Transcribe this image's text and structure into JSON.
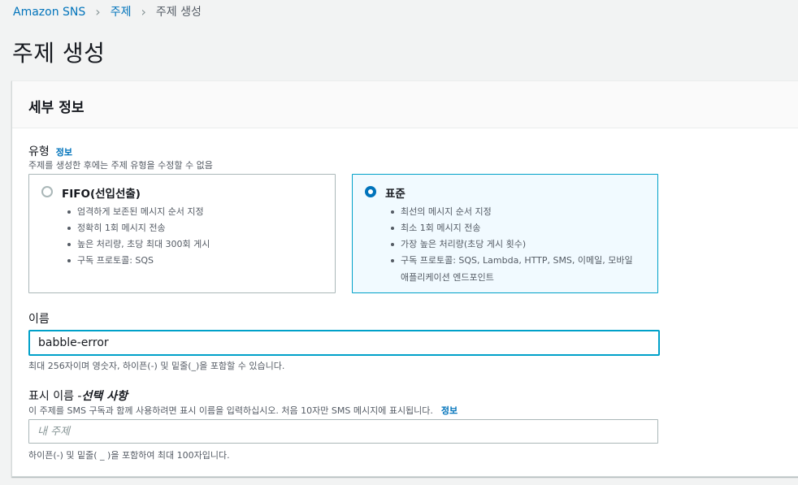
{
  "breadcrumb": {
    "items": [
      "Amazon SNS",
      "주제"
    ],
    "current": "주제 생성"
  },
  "page": {
    "title": "주제 생성"
  },
  "panel": {
    "title": "세부 정보"
  },
  "type_field": {
    "label": "유형",
    "info": "정보",
    "description": "주제를 생성한 후에는 주제 유형을 수정할 수 없음",
    "options": [
      {
        "title": "FIFO(선입선출)",
        "selected": false,
        "bullets": [
          "엄격하게 보존된 메시지 순서 지정",
          "정확히 1회 메시지 전송",
          "높은 처리량, 초당 최대 300회 게시",
          "구독 프로토콜: SQS"
        ]
      },
      {
        "title": "표준",
        "selected": true,
        "bullets": [
          "최선의 메시지 순서 지정",
          "최소 1회 메시지 전송",
          "가장 높은 처리량(초당 게시 횟수)",
          "구독 프로토콜: SQS, Lambda, HTTP, SMS, 이메일, 모바일",
          "애플리케이션 엔드포인트"
        ]
      }
    ]
  },
  "name_field": {
    "label": "이름",
    "value": "babble-error",
    "hint": "최대 256자이며 영숫자, 하이픈(-) 및 밑줄(_)을 포함할 수 있습니다."
  },
  "display_name_field": {
    "label": "표시 이름 - ",
    "label_optional": "선택 사항",
    "description": "이 주제를 SMS 구독과 함께 사용하려면 표시 이름을 입력하십시오. 처음 10자만 SMS 메시지에 표시됩니다.",
    "info": "정보",
    "placeholder": "내 주제",
    "hint": "하이픈(-) 및 밑줄( _ )을 포함하여 최대 100자입니다."
  },
  "colors": {
    "accent": "#0073bb",
    "selected_border": "#00a1c9",
    "selected_bg": "#f1faff"
  }
}
